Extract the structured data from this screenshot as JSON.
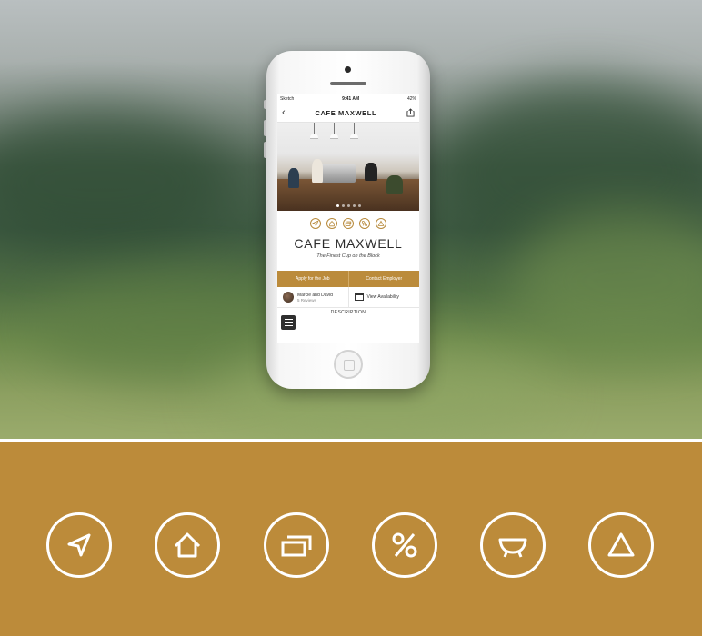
{
  "phone_screen": {
    "status_bar": {
      "carrier": "Sketch",
      "time": "9:41 AM",
      "battery": "42%"
    },
    "header": {
      "title": "CAFE MAXWELL",
      "back_icon": "chevron-left-icon",
      "share_icon": "share-icon"
    },
    "carousel": {
      "slide_count": 5,
      "active_slide": 1
    },
    "mini_icons": [
      "location-arrow-icon",
      "home-icon",
      "cards-icon",
      "percent-icon",
      "bowl-icon"
    ],
    "cafe_name": "CAFE MAXWELL",
    "tagline": "The Finest Cup on the Block",
    "actions": {
      "apply": "Apply for the Job",
      "contact": "Contact Employer"
    },
    "owners": {
      "name": "Marcie and David",
      "reviews": "5 Reviews"
    },
    "availability": "View Availability",
    "description_label": "DESCRIPTION"
  },
  "icon_band": {
    "background": "#bc8b3a",
    "icons": [
      "location-arrow-icon",
      "home-icon",
      "cards-icon",
      "percent-icon",
      "bowl-icon",
      "triangle-icon"
    ]
  }
}
